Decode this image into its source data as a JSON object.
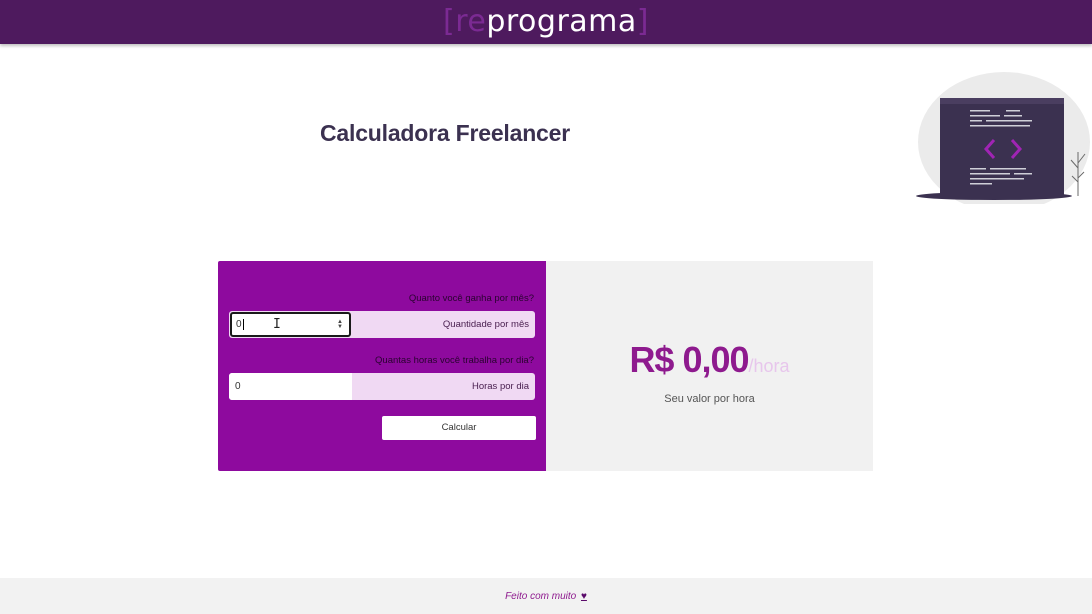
{
  "header": {
    "brand_open": "[",
    "brand_re": "re",
    "brand_rest": "programa",
    "brand_close": "]"
  },
  "page_title": "Calculadora Freelancer",
  "form": {
    "income_label": "Quanto você ganha por mês?",
    "income_value": "0",
    "income_tag": "Quantidade por mês",
    "hours_label": "Quantas horas você trabalha por dia?",
    "hours_value": "0",
    "hours_tag": "Horas por dia",
    "submit_label": "Calcular"
  },
  "result": {
    "amount": "R$ 0,00",
    "unit": "/hora",
    "caption": "Seu valor por hora"
  },
  "footer": {
    "text": "Feito com muito",
    "heart": "♥"
  },
  "colors": {
    "header_bg": "#4e1a5e",
    "accent": "#8e0a9e",
    "result_text": "#8e1a8e",
    "result_bg": "#f1f1f1"
  },
  "icons": {
    "code_window": "code-window-illustration",
    "spinner": "spinner-arrows-icon",
    "heart": "heart-icon"
  }
}
